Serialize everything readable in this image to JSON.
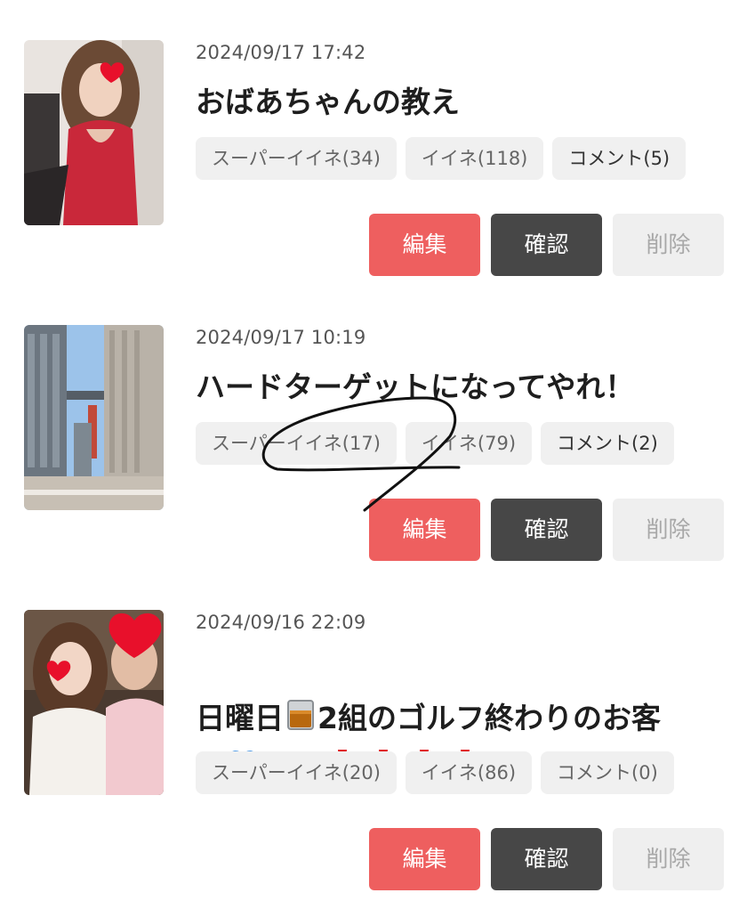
{
  "posts": [
    {
      "date": "2024/09/17 17:42",
      "title": "おばあちゃんの教え",
      "stats": {
        "super_like": "スーパーイイネ(34)",
        "like": "イイネ(118)",
        "comment": "コメント(5)"
      },
      "actions": {
        "edit": "編集",
        "confirm": "確認",
        "delete": "削除"
      }
    },
    {
      "date": "2024/09/17 10:19",
      "title": "ハードターゲットになってやれ！",
      "stats": {
        "super_like": "スーパーイイネ(17)",
        "like": "イイネ(79)",
        "comment": "コメント(2)"
      },
      "actions": {
        "edit": "編集",
        "confirm": "確認",
        "delete": "削除"
      }
    },
    {
      "date": "2024/09/16 22:09",
      "title_part1": "日曜日",
      "title_part2": "2組のゴルフ終わりのお客",
      "title_part3": "様",
      "title_part4": "男男",
      "stats": {
        "super_like": "スーパーイイネ(20)",
        "like": "イイネ(86)",
        "comment": "コメント(0)"
      },
      "actions": {
        "edit": "編集",
        "confirm": "確認",
        "delete": "削除"
      }
    }
  ],
  "icons": {
    "whisky": "whisky-glass-icon",
    "heart_blue": "blue-heart-icon",
    "exclamation": "red-exclamation-icon"
  },
  "colors": {
    "edit": "#ee5f5f",
    "confirm": "#474747",
    "delete": "#efefef",
    "chip": "#f0f0f0"
  }
}
